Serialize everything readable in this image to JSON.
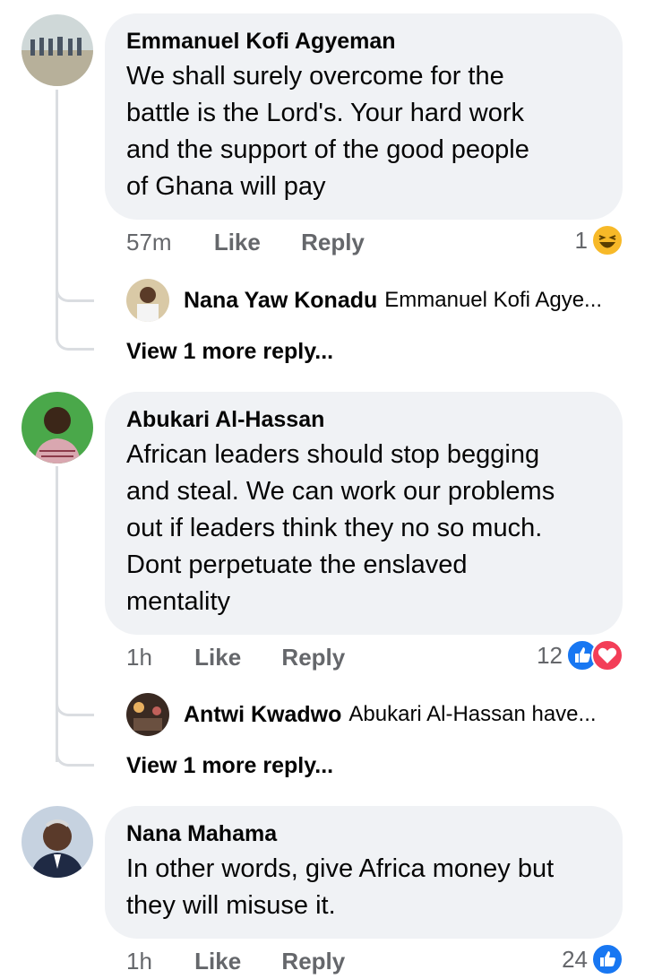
{
  "comments": [
    {
      "author": "Emmanuel Kofi Agyeman",
      "text_lines": [
        "We shall surely overcome for the",
        "battle is the Lord's. Your hard work",
        "and the support of the good people",
        "of Ghana will pay"
      ],
      "time": "57m",
      "like": "Like",
      "reply": "Reply",
      "reaction_count": "1",
      "reactions": [
        "haha-icon"
      ],
      "reply_preview": {
        "author": "Nana Yaw Konadu",
        "snippet": "Emmanuel Kofi Agye..."
      },
      "more_replies": "View 1 more reply..."
    },
    {
      "author": "Abukari Al-Hassan",
      "text_lines": [
        "African leaders should stop begging",
        "and steal. We can work our problems",
        "out if leaders think they no so much.",
        "Dont perpetuate the enslaved",
        "mentality"
      ],
      "time": "1h",
      "like": "Like",
      "reply": "Reply",
      "reaction_count": "12",
      "reactions": [
        "like-icon",
        "love-icon"
      ],
      "reply_preview": {
        "author": "Antwi Kwadwo",
        "snippet": "Abukari Al-Hassan have..."
      },
      "more_replies": "View 1 more reply..."
    },
    {
      "author": "Nana Mahama",
      "text_lines": [
        "In other words, give Africa money but",
        "they will misuse it."
      ],
      "time": "1h",
      "like": "Like",
      "reply": "Reply",
      "reaction_count": "24",
      "reactions": [
        "like-icon"
      ]
    }
  ],
  "colors": {
    "bubble": "#f0f2f5",
    "meta": "#65676b",
    "like_blue": "#1877f2",
    "love_red": "#f33e58",
    "haha_yellow": "#f7b928"
  }
}
